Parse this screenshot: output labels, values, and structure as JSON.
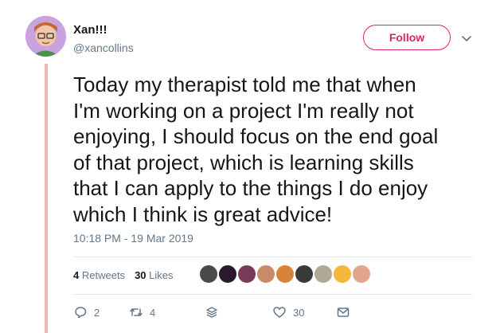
{
  "author": {
    "display_name": "Xan!!!",
    "handle": "@xancollins"
  },
  "follow_button": {
    "label": "Follow"
  },
  "tweet": {
    "text": "Today my therapist told me that when\nI'm working on a project I'm really not\nenjoying, I should focus on the end goal\nof that project, which is learning skills\nthat I can apply to the things I do enjoy\nwhich I think is great advice!",
    "timestamp": "10:18 PM - 19 Mar 2019"
  },
  "stats": {
    "retweets_count": "4",
    "retweets_label": "Retweets",
    "likes_count": "30",
    "likes_label": "Likes"
  },
  "likers": [
    {
      "icon": "avatar",
      "color": "#4a4a4a"
    },
    {
      "icon": "avatar",
      "color": "#2a1a2e"
    },
    {
      "icon": "avatar",
      "color": "#7a3b5a"
    },
    {
      "icon": "avatar",
      "color": "#c98a6a"
    },
    {
      "icon": "avatar",
      "color": "#d9823b"
    },
    {
      "icon": "avatar",
      "color": "#3a3a3a"
    },
    {
      "icon": "avatar",
      "color": "#b0a898"
    },
    {
      "icon": "avatar",
      "color": "#f4b73b"
    },
    {
      "icon": "avatar",
      "color": "#e3a58d"
    }
  ],
  "actions": {
    "replies": "2",
    "retweets": "4",
    "likes": "30"
  },
  "colors": {
    "accent": "#e0245e",
    "thread_line": "#f5b8b8",
    "muted_text": "#657786"
  }
}
